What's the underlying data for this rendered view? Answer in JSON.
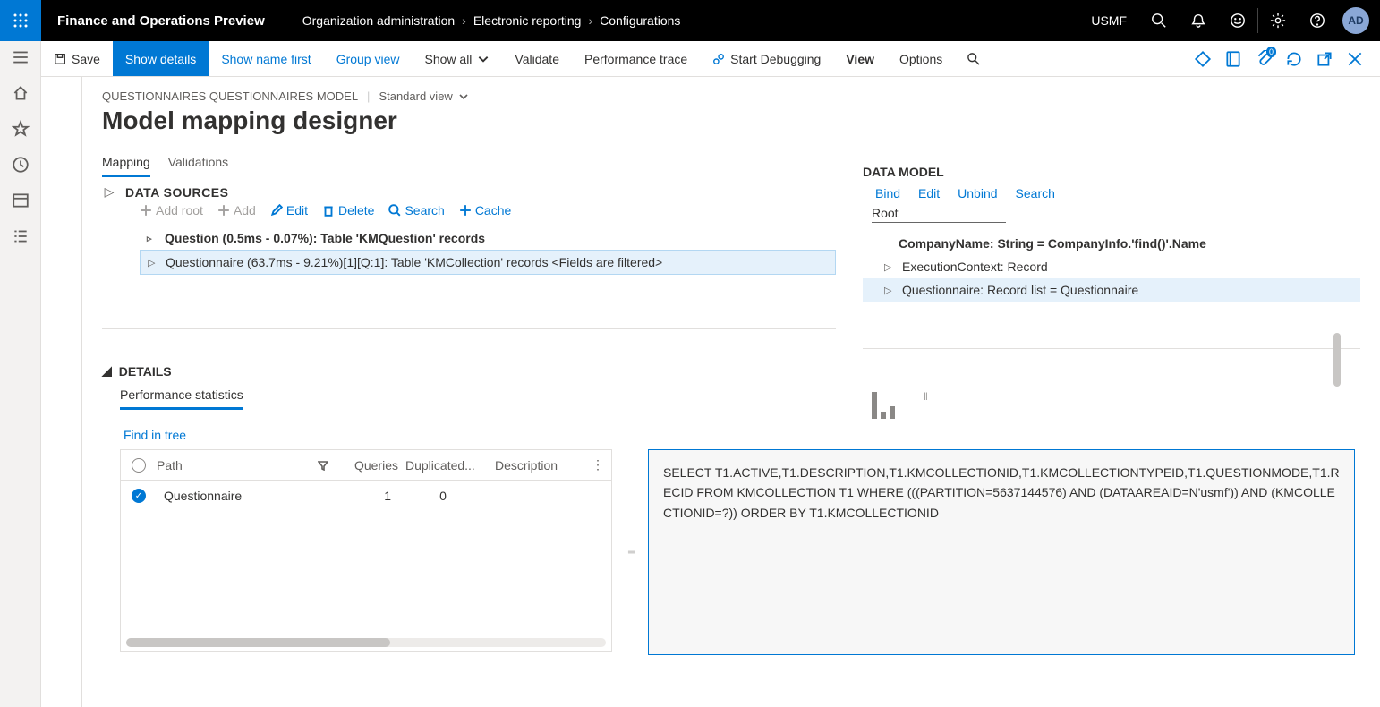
{
  "topbar": {
    "app_title": "Finance and Operations Preview",
    "breadcrumbs": [
      "Organization administration",
      "Electronic reporting",
      "Configurations"
    ],
    "env": "USMF",
    "avatar": "AD"
  },
  "cmdbar": {
    "save": "Save",
    "show_details": "Show details",
    "show_name_first": "Show name first",
    "group_view": "Group view",
    "show_all": "Show all",
    "validate": "Validate",
    "perf_trace": "Performance trace",
    "start_debug": "Start Debugging",
    "view": "View",
    "options": "Options",
    "attach_badge": "0"
  },
  "page": {
    "context": "QUESTIONNAIRES QUESTIONNAIRES MODEL",
    "view_name": "Standard view",
    "title": "Model mapping designer",
    "tabs": {
      "mapping": "Mapping",
      "validations": "Validations"
    }
  },
  "ds": {
    "title": "DATA SOURCES",
    "add_root": "Add root",
    "add": "Add",
    "edit": "Edit",
    "delete": "Delete",
    "search": "Search",
    "cache": "Cache",
    "row1": "Question (0.5ms - 0.07%): Table 'KMQuestion' records",
    "row2": "Questionnaire (63.7ms - 9.21%)[1][Q:1]: Table 'KMCollection' records <Fields are filtered>"
  },
  "dm": {
    "title": "DATA MODEL",
    "bind": "Bind",
    "edit": "Edit",
    "unbind": "Unbind",
    "search": "Search",
    "root": "Root",
    "row1": "CompanyName: String = CompanyInfo.'find()'.Name",
    "row2": "ExecutionContext: Record",
    "row3": "Questionnaire: Record list = Questionnaire"
  },
  "details": {
    "title": "DETAILS",
    "subtab": "Performance statistics",
    "find": "Find in tree",
    "columns": {
      "path": "Path",
      "queries": "Queries",
      "dup": "Duplicated...",
      "desc": "Description"
    },
    "rows": [
      {
        "path": "Questionnaire",
        "queries": "1",
        "dup": "0",
        "desc": ""
      }
    ],
    "sql": "SELECT T1.ACTIVE,T1.DESCRIPTION,T1.KMCOLLECTIONID,T1.KMCOLLECTIONTYPEID,T1.QUESTIONMODE,T1.RECID FROM KMCOLLECTION T1 WHERE (((PARTITION=5637144576) AND (DATAAREAID=N'usmf')) AND (KMCOLLECTIONID=?)) ORDER BY T1.KMCOLLECTIONID"
  }
}
